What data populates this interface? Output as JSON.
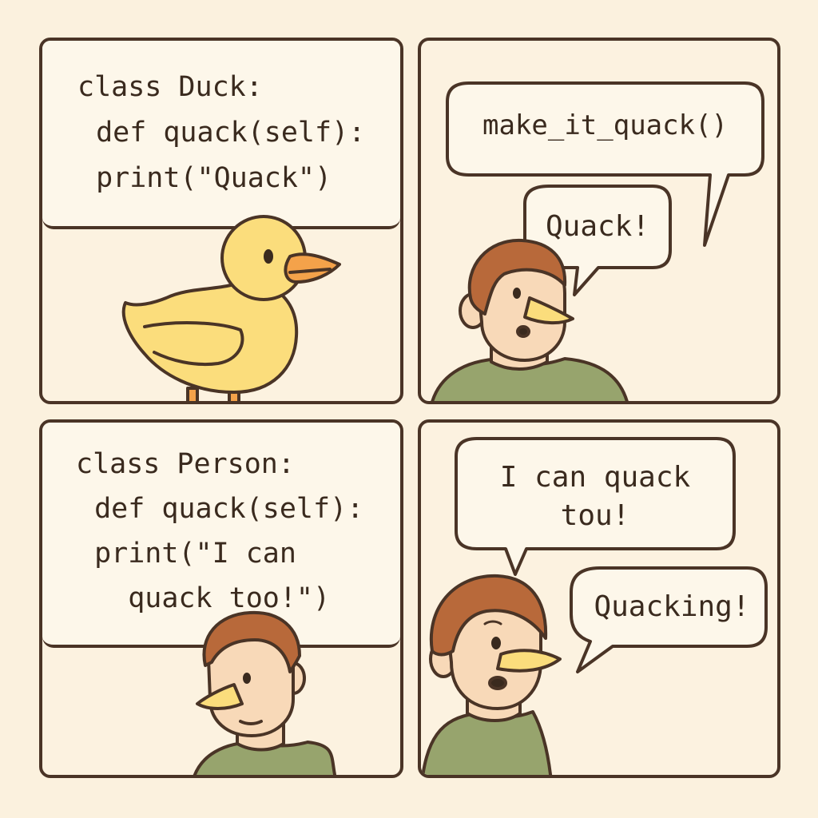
{
  "panels": {
    "duck_code": {
      "lines": [
        "class Duck:",
        " def quack(self):",
        " print(\"Quack\")"
      ]
    },
    "call": {
      "call_bubble": "make_it_quack()",
      "response_bubble": "Quack!"
    },
    "person_code": {
      "lines": [
        "class Person:",
        " def quack(self):",
        " print(\"I can",
        "   quack too!\")"
      ]
    },
    "boast": {
      "bubble_line1": "I can quack",
      "bubble_line2": "tou!",
      "response_bubble": "Quacking!"
    }
  },
  "colors": {
    "background": "#fbf1de",
    "outline": "#4a3426",
    "duck_yellow": "#fbdd7c",
    "beak_orange": "#f4a24a",
    "hair": "#b8693a",
    "skin": "#f8d9b8",
    "shirt": "#97a46d"
  }
}
